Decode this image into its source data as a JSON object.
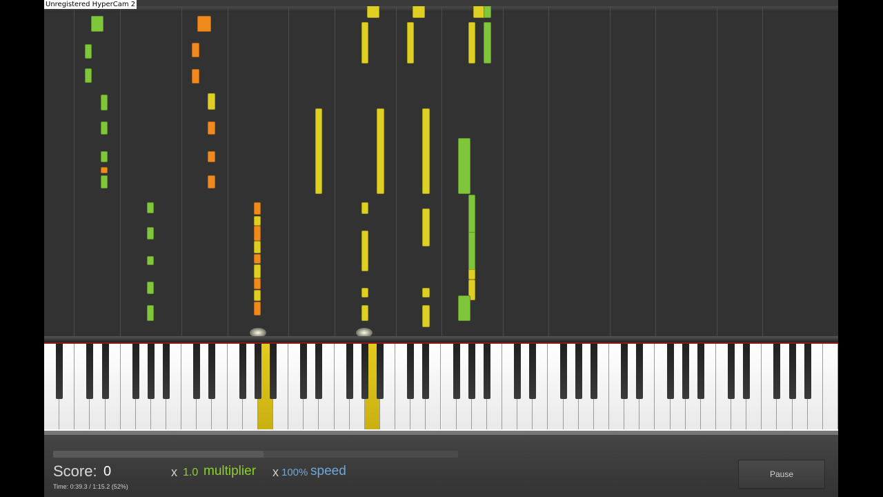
{
  "watermark": "Unregistered HyperCam 2",
  "score": {
    "label": "Score:",
    "value": "0"
  },
  "time": {
    "text": "Time:  0:39.3  /  1:15.2  (52%)"
  },
  "progress": {
    "fraction": 0.52
  },
  "multiplier": {
    "x": "x",
    "value": "1.0",
    "label": "multiplier"
  },
  "speed": {
    "x": "x",
    "value": "100%",
    "label": "speed"
  },
  "pause_button": {
    "label": "Pause"
  },
  "colors": {
    "background": "#323232",
    "note_green": "#7fc63a",
    "note_yellow": "#dfcf23",
    "note_orange": "#f08a1c",
    "multiplier_green": "#8ad12a",
    "speed_blue": "#6fa7d8"
  }
}
